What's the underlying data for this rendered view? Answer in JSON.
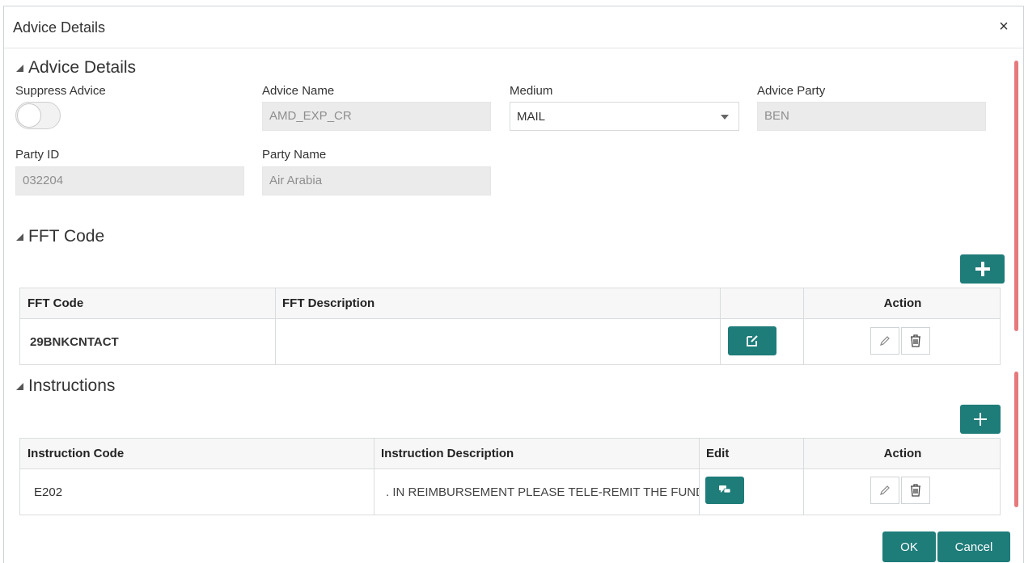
{
  "dialog": {
    "title": "Advice Details",
    "close_glyph": "×"
  },
  "advice_section": {
    "title": "Advice Details",
    "suppress_advice": {
      "label": "Suppress Advice",
      "on": false
    },
    "advice_name": {
      "label": "Advice Name",
      "value": "AMD_EXP_CR"
    },
    "medium": {
      "label": "Medium",
      "value": "MAIL"
    },
    "advice_party": {
      "label": "Advice Party",
      "value": "BEN"
    },
    "party_id": {
      "label": "Party ID",
      "value": "032204"
    },
    "party_name": {
      "label": "Party Name",
      "value": "Air Arabia"
    }
  },
  "fft_section": {
    "title": "FFT Code",
    "add_icon": "plus-icon",
    "columns": [
      "FFT Code",
      "FFT Description",
      "",
      "Action"
    ],
    "rows": [
      {
        "code": "29BNKCNTACT",
        "description": ""
      }
    ]
  },
  "instructions_section": {
    "title": "Instructions",
    "add_icon": "plus-icon",
    "columns": [
      "Instruction Code",
      "Instruction Description",
      "Edit",
      "Action"
    ],
    "rows": [
      {
        "code": "E202",
        "description": ". IN REIMBURSEMENT PLEASE TELE-REMIT THE FUND"
      }
    ]
  },
  "footer": {
    "ok_label": "OK",
    "cancel_label": "Cancel"
  },
  "colors": {
    "accent": "#1e7c79",
    "scrollbar": "#e5797c"
  }
}
